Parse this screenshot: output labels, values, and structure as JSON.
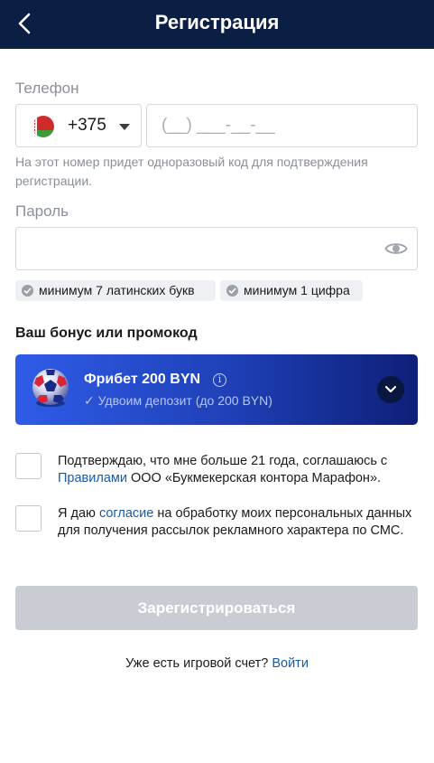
{
  "header": {
    "title": "Регистрация",
    "back_icon": "chevron-left-icon"
  },
  "phone": {
    "label": "Телефон",
    "country_flag": "belarus-flag-icon",
    "country_code": "+375",
    "placeholder": "(__) ___-__-__",
    "hint": "На этот номер придет одноразовый код для подтверждения регистрации."
  },
  "password": {
    "label": "Пароль",
    "value": "",
    "eye_icon": "eye-icon",
    "requirements": [
      "минимум 7 латинских букв",
      "минимум 1 цифра"
    ]
  },
  "bonus": {
    "section_title": "Ваш бонус или промокод",
    "name": "Фрибет 200 BYN",
    "description": "✓ Удвоим депозит (до 200 BYN)"
  },
  "consents": {
    "age": {
      "before": "Подтверждаю, что мне больше 21 года, соглашаюсь с ",
      "link": "Правилами",
      "after": " ООО «Букмекерская контора Марафон».",
      "checked": false
    },
    "sms": {
      "before": "Я даю ",
      "link": "согласие",
      "after": " на обработку моих персональных данных для получения рассылок рекламного характера по СМС.",
      "checked": false
    }
  },
  "register_button": "Зарегистрироваться",
  "login": {
    "question": "Уже есть игровой счет? ",
    "link": "Войти"
  },
  "colors": {
    "header": "#0b1f45",
    "accent_link": "#1a5aa6",
    "button_disabled": "#c9cdd3",
    "bonus_gradient_start": "#2f5ce8",
    "bonus_gradient_end": "#0e1f78"
  }
}
